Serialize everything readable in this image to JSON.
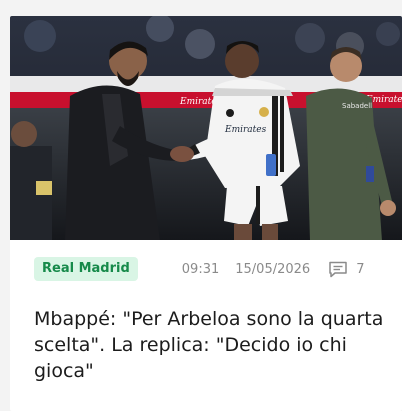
{
  "article": {
    "image": {
      "subject": "two men shaking hands pitch-side in a stadium",
      "board_text_left": "Emirates",
      "board_text_right": "Emirates",
      "jersey_text": "Emirates",
      "staff_jacket_text": "Sabadell"
    },
    "category_tag": "Real Madrid",
    "time": "09:31",
    "date": "15/05/2026",
    "comments_count": "7",
    "headline": "Mbappé: \"Per Arbeloa sono la quarta scelta\". La replica: \"Decido io chi gioca\""
  },
  "colors": {
    "tag_background": "#d9f5e5",
    "tag_text": "#168a4a",
    "meta_text": "#8a8a8a",
    "headline_text": "#1c1c1c"
  },
  "icons": {
    "comments": "comment-bubble-icon"
  }
}
